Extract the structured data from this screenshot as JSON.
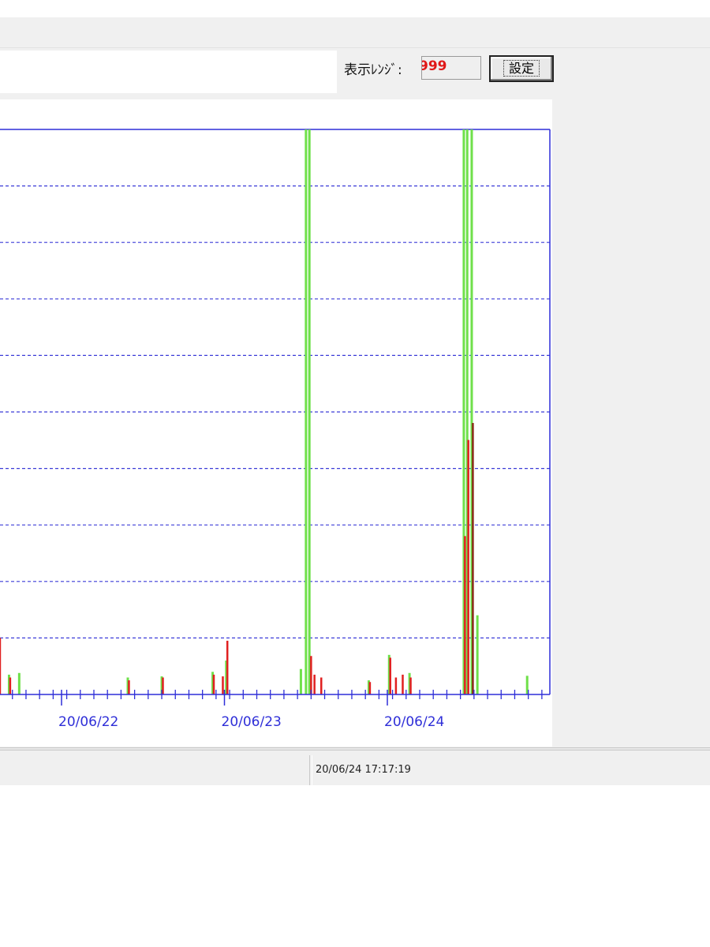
{
  "toolbar": {
    "range_label": "表示ﾚﾝｼﾞ:",
    "range_value": "999",
    "set_button_label": "設定"
  },
  "status_bar": {
    "timestamp": "20/06/24 17:17:19"
  },
  "colors": {
    "axis": "#2f2fd8",
    "grid": "#3c3cd8",
    "series_green": "#6fe04a",
    "series_red": "#e02020",
    "series_dark": "#8a2a18"
  },
  "chart_data": {
    "type": "bar",
    "x_tick_labels": [
      "20/06/22",
      "20/06/23",
      "20/06/24"
    ],
    "grid": true,
    "ylim": [
      0,
      999
    ],
    "series": [
      {
        "color": "green",
        "points": [
          {
            "x": "20/06/21 10:00",
            "value": 105
          },
          {
            "x": "20/06/21 11:30",
            "value": 35
          },
          {
            "x": "20/06/21 13:00",
            "value": 38
          },
          {
            "x": "20/06/22 05:00",
            "value": 30
          },
          {
            "x": "20/06/22 10:00",
            "value": 32
          },
          {
            "x": "20/06/22 17:30",
            "value": 40
          },
          {
            "x": "20/06/22 19:30",
            "value": 60
          },
          {
            "x": "20/06/23 06:30",
            "value": 45
          },
          {
            "x": "20/06/23 07:15",
            "value": 999
          },
          {
            "x": "20/06/23 07:45",
            "value": 999
          },
          {
            "x": "20/06/23 16:30",
            "value": 25
          },
          {
            "x": "20/06/23 19:30",
            "value": 70
          },
          {
            "x": "20/06/23 22:30",
            "value": 38
          },
          {
            "x": "20/06/24 06:30",
            "value": 999
          },
          {
            "x": "20/06/24 07:00",
            "value": 999
          },
          {
            "x": "20/06/24 07:40",
            "value": 999
          },
          {
            "x": "20/06/24 08:30",
            "value": 140
          },
          {
            "x": "20/06/24 15:50",
            "value": 33
          }
        ]
      },
      {
        "color": "red",
        "points": [
          {
            "x": "20/06/21 10:10",
            "value": 100
          },
          {
            "x": "20/06/21 11:40",
            "value": 30
          },
          {
            "x": "20/06/22 05:10",
            "value": 25
          },
          {
            "x": "20/06/22 10:10",
            "value": 30
          },
          {
            "x": "20/06/22 17:40",
            "value": 35
          },
          {
            "x": "20/06/22 19:00",
            "value": 32
          },
          {
            "x": "20/06/22 19:40",
            "value": 95
          },
          {
            "x": "20/06/23 08:00",
            "value": 68
          },
          {
            "x": "20/06/23 08:30",
            "value": 35
          },
          {
            "x": "20/06/23 09:30",
            "value": 30
          },
          {
            "x": "20/06/23 16:40",
            "value": 22
          },
          {
            "x": "20/06/23 19:40",
            "value": 65
          },
          {
            "x": "20/06/23 20:30",
            "value": 30
          },
          {
            "x": "20/06/23 21:30",
            "value": 35
          },
          {
            "x": "20/06/23 22:40",
            "value": 30
          },
          {
            "x": "20/06/24 06:40",
            "value": 280
          },
          {
            "x": "20/06/24 07:10",
            "value": 450
          }
        ]
      },
      {
        "color": "dark",
        "points": [
          {
            "x": "20/06/24 07:50",
            "value": 480
          }
        ]
      }
    ]
  }
}
